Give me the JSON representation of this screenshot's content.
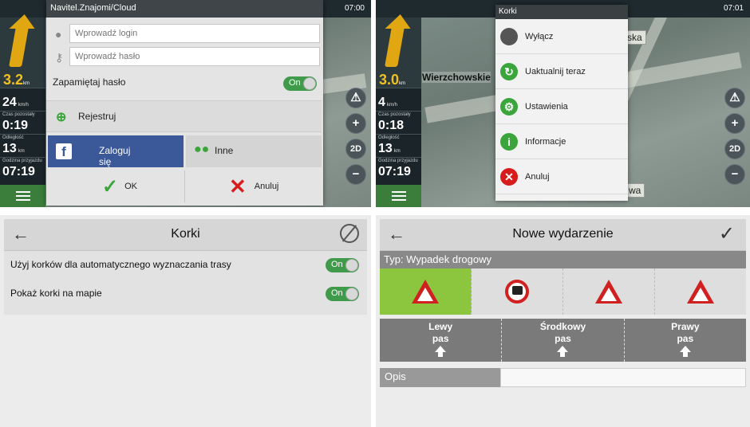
{
  "common": {
    "speed": "3.2",
    "speed_unit": "km",
    "speed_row2": "24",
    "speed_row2_unit": "km/h",
    "time_left_label": "Czas pozostały",
    "time_left": "0:19",
    "distance_label": "Odległość",
    "distance": "13",
    "distance_unit": "km",
    "arrival_label": "Godzina przyjazdu",
    "arrival": "07:19",
    "btn_2d": "2D"
  },
  "panel1": {
    "clock": "07:00",
    "dialog_title": "Navitel.Znajomi/Cloud",
    "login_placeholder": "Wprowadź login",
    "password_placeholder": "Wprowadź hasło",
    "remember_label": "Zapamiętaj hasło",
    "remember_toggle": "On",
    "register_label": "Rejestruj",
    "facebook_label": "Zaloguj się",
    "facebook_glyph": "f",
    "other_label": "Inne",
    "ok_label": "OK",
    "cancel_label": "Anuluj"
  },
  "panel2": {
    "clock": "07:01",
    "speed": "3.0",
    "speed_row2": "4",
    "time_left": "0:18",
    "distance": "13",
    "arrival": "07:19",
    "street_label": "Wierzchowskie",
    "street_box1": "ska",
    "street_box2": "wa",
    "menu_title": "Korki",
    "menu_items": [
      {
        "label": "Wyłącz",
        "icon": "traffic-off-icon",
        "color": "#555555",
        "glyph": ""
      },
      {
        "label": "Uaktualnij teraz",
        "icon": "refresh-icon",
        "color": "#3aa53a",
        "glyph": "↻"
      },
      {
        "label": "Ustawienia",
        "icon": "gear-icon",
        "color": "#3aa53a",
        "glyph": "⚙"
      },
      {
        "label": "Informacje",
        "icon": "info-icon",
        "color": "#3aa53a",
        "glyph": "i"
      },
      {
        "label": "Anuluj",
        "icon": "close-icon",
        "color": "#d81c1c",
        "glyph": "✕"
      }
    ]
  },
  "panel3": {
    "title": "Korki",
    "rows": [
      {
        "label": "Użyj korków dla automatycznego wyznaczania trasy",
        "toggle": "On"
      },
      {
        "label": "Pokaż korki na mapie",
        "toggle": "On"
      }
    ]
  },
  "panel4": {
    "title": "Nowe wydarzenie",
    "type_label": "Typ: Wypadek drogowy",
    "event_icons": [
      "accident-icon",
      "speed-camera-icon",
      "roadworks-icon",
      "warning-icon"
    ],
    "lanes": [
      {
        "line1": "Lewy",
        "line2": "pas"
      },
      {
        "line1": "Środkowy",
        "line2": "pas"
      },
      {
        "line1": "Prawy",
        "line2": "pas"
      }
    ],
    "desc_label": "Opis"
  },
  "colors": {
    "accent_green": "#3f9b4a",
    "facebook_blue": "#3b5998",
    "selected_event": "#8cc63f",
    "cancel_red": "#d81c1c"
  }
}
